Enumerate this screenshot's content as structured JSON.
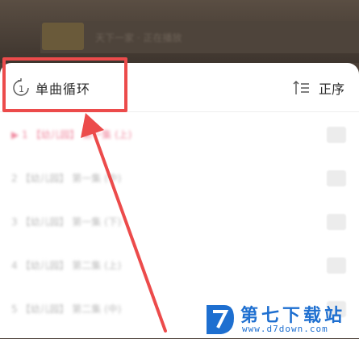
{
  "background": {
    "title_text": "天下一家 · 正在播放"
  },
  "header": {
    "mode_label": "单曲循环",
    "mode_icon": "repeat-one-icon",
    "sort_label": "正序",
    "sort_icon": "sort-ascending-icon"
  },
  "playlist": {
    "items": [
      {
        "text": "▶  1  【幼儿园】 第一集 (上)",
        "active": true
      },
      {
        "text": "2  【幼儿园】 第一集 (中)",
        "active": false
      },
      {
        "text": "3  【幼儿园】 第一集 (下)",
        "active": false
      },
      {
        "text": "4  【幼儿园】 第二集 (上)",
        "active": false
      },
      {
        "text": "5  【幼儿园】 第二集 (中)",
        "active": false
      }
    ]
  },
  "watermark": {
    "title": "第七下载站",
    "url": "www.d7down.com"
  },
  "colors": {
    "highlight": "#ec4b4b",
    "active_track": "#f08aa0",
    "watermark_blue": "#1e6fd0"
  }
}
